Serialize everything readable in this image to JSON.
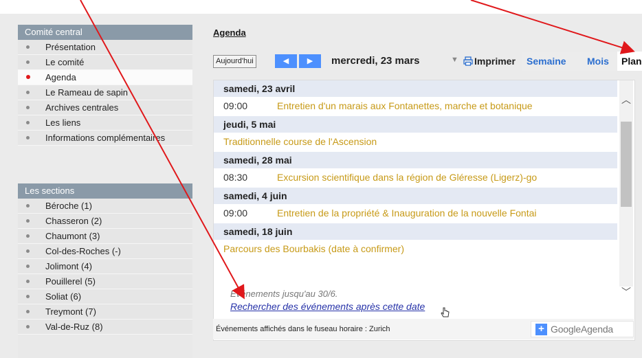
{
  "main_nav": {
    "title": "Comité central",
    "items": [
      {
        "label": "Présentation",
        "active": false
      },
      {
        "label": "Le comité",
        "active": false
      },
      {
        "label": "Agenda",
        "active": true
      },
      {
        "label": "Le Rameau de sapin",
        "active": false
      },
      {
        "label": "Archives centrales",
        "active": false
      },
      {
        "label": "Les liens",
        "active": false
      },
      {
        "label": "Informations complémentaires",
        "active": false
      }
    ]
  },
  "sections_nav": {
    "title": "Les sections",
    "items": [
      {
        "label": "Béroche (1)"
      },
      {
        "label": "Chasseron (2)"
      },
      {
        "label": "Chaumont (3)"
      },
      {
        "label": "Col-des-Roches (-)"
      },
      {
        "label": "Jolimont (4)"
      },
      {
        "label": "Pouillerel (5)"
      },
      {
        "label": "Soliat (6)"
      },
      {
        "label": "Treymont (7)"
      },
      {
        "label": "Val-de-Ruz (8)"
      }
    ]
  },
  "agenda": {
    "title": "Agenda",
    "toolbar": {
      "today": "Aujourd'hui",
      "prev_icon": "chevron-left-icon",
      "next_icon": "chevron-right-icon",
      "date": "mercredi, 23 mars",
      "dropdown_icon": "caret-down-icon",
      "print": "Imprimer",
      "tabs": {
        "week": "Semaine",
        "month": "Mois",
        "plan": "Planning"
      }
    },
    "days": [
      {
        "date": "samedi, 23 avril",
        "events": [
          {
            "time": "09:00",
            "title": "Entretien d'un marais aux Fontanettes, marche et botanique"
          }
        ]
      },
      {
        "date": "jeudi, 5 mai",
        "events": [
          {
            "time": "",
            "title": "Traditionnelle course de l'Ascension"
          }
        ]
      },
      {
        "date": "samedi, 28 mai",
        "events": [
          {
            "time": "08:30",
            "title": "Excursion scientifique dans la région de Gléresse (Ligerz)-go"
          }
        ]
      },
      {
        "date": "samedi, 4 juin",
        "events": [
          {
            "time": "09:00",
            "title": "Entretien de la propriété & Inauguration de la nouvelle Fontai"
          }
        ]
      },
      {
        "date": "samedi, 18 juin",
        "events": [
          {
            "time": "",
            "title": "Parcours des Bourbakis (date à confirmer)"
          }
        ]
      }
    ],
    "footer_note": "Événements jusqu'au 30/6.",
    "search_link": "Rechercher des événements après cette date",
    "timezone_note": "Événements affichés dans le fuseau horaire : Zurich",
    "badge": "GoogleAgenda"
  },
  "colors": {
    "nav_header": "#8a9aa8",
    "active_dot": "#e0181b",
    "event_title": "#c79a17",
    "link": "#2632a8",
    "tab_link": "#2b6ecf",
    "arrow": "#e0181b",
    "google_blue": "#4d90fe"
  }
}
